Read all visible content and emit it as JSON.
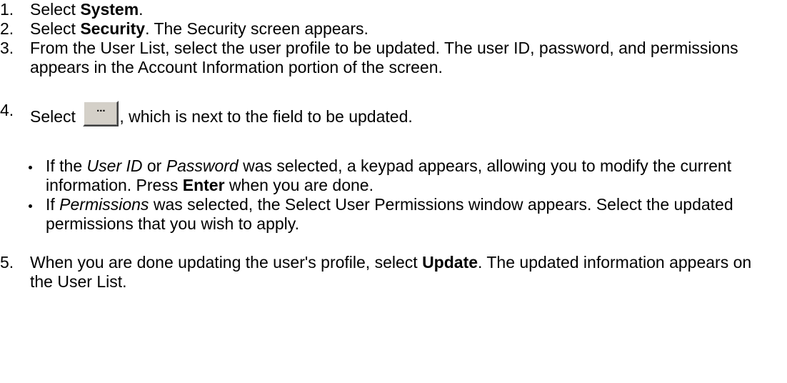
{
  "steps": [
    {
      "num": "1.",
      "pre": "Select ",
      "bold": "System",
      "post": "."
    },
    {
      "num": "2.",
      "pre": "Select ",
      "bold": "Security",
      "post": ". The Security screen appears."
    },
    {
      "num": "3.",
      "text": "From the User List, select the user profile to be updated. The user ID, password, and permissions appears in the Account Information portion of the screen."
    },
    {
      "num": "4.",
      "pre": "Select ",
      "button_label": "...",
      "post": ", which is next to the field to be updated."
    },
    {
      "num": "5.",
      "pre": "When you are done updating the user's profile, select ",
      "bold": "Update",
      "post": ". The updated information appears on the User List."
    }
  ],
  "bullets": [
    {
      "t1": "If the ",
      "i1": "User ID",
      "t2": " or ",
      "i2": "Password",
      "t3": " was selected, a keypad appears, allowing you to modify the current information. Press ",
      "b1": "Enter",
      "t4": " when you are done."
    },
    {
      "t1": "If ",
      "i1": "Permissions",
      "t2": " was selected, the Select User Permissions window appears. Select the updated permissions that you wish to apply."
    }
  ]
}
